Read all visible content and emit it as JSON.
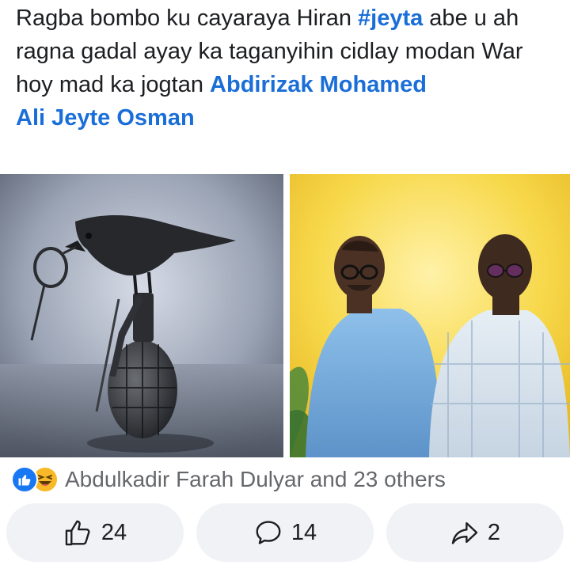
{
  "post": {
    "text_part1": "Ragba bombo ku cayaraya Hiran ",
    "hashtag": "#jeyta",
    "text_part2": " abe u ah ragna gadal ayay ka taganyihin cidlay modan War hoy mad ka jogtan ",
    "mentions": [
      "Abdirizak Mohamed",
      "Ali Jeyte Osman"
    ]
  },
  "media": {
    "photo_left": "crow-on-grenade-image",
    "photo_right": "two-men-portrait-image"
  },
  "reactions": {
    "types": [
      "like",
      "haha"
    ],
    "summary": "Abdulkadir Farah Dulyar and 23 others"
  },
  "actions": {
    "like_count": "24",
    "comment_count": "14",
    "share_count": "2"
  },
  "colors": {
    "link": "#1a6ed8",
    "like_blue": "#1877f2",
    "haha_yellow": "#f7b928",
    "button_bg": "#f0f2f5"
  }
}
